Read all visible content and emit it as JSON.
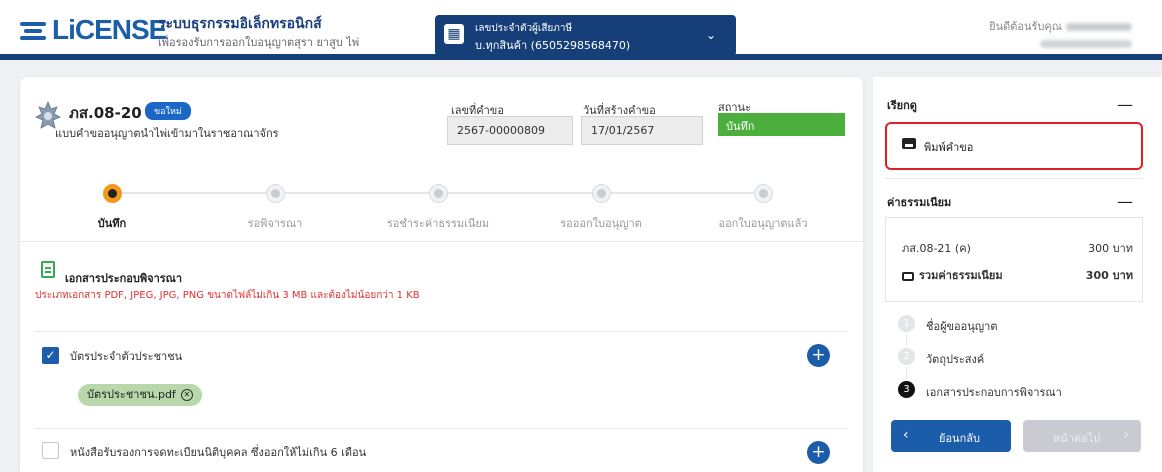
{
  "header": {
    "logo_text": "LiCENSE",
    "system_title": "ระบบธุรกรรมอิเล็กทรอนิกส์",
    "system_subtitle": "เพื่อรองรับการออกใบอนุญาตสุรา ยาสูบ ไพ่",
    "taxpayer_label": "เลขประจำตัวผู้เสียภาษี",
    "taxpayer_value": "บ.ทุกสินค้า (6505298568470)",
    "welcome_text": "ยินดีต้อนรับคุณ"
  },
  "form": {
    "code": "ภส.08-20",
    "badge": "ขอใหม่",
    "name": "แบบคำขออนุญาตนำไพ่เข้ามาในราชอาณาจักร",
    "request_no_label": "เลขที่คำขอ",
    "request_no": "2567-00000809",
    "created_label": "วันที่สร้างคำขอ",
    "created_date": "17/01/2567",
    "status_label": "สถานะ",
    "status_value": "บันทึก"
  },
  "steps": [
    {
      "label": "บันทึก",
      "active": true
    },
    {
      "label": "รอพิจารณา",
      "active": false
    },
    {
      "label": "รอชำระค่าธรรมเนียม",
      "active": false
    },
    {
      "label": "รอออกใบอนุญาต",
      "active": false
    },
    {
      "label": "ออกใบอนุญาตแล้ว",
      "active": false
    }
  ],
  "documents": {
    "title": "เอกสารประกอบพิจารณา",
    "note": "ประเภทเอกสาร PDF, JPEG, JPG, PNG ขนาดไฟล์ไม่เกิน 3 MB และต้องไม่น้อยกว่า 1 KB",
    "items": [
      {
        "label": "บัตรประจำตัวประชาชน",
        "checked": true,
        "file": "บัตรประชาชน.pdf"
      },
      {
        "label": "หนังสือรับรองการจดทะเบียนนิติบุคคล ซึ่งออกให้ไม่เกิน 6 เดือน",
        "checked": false
      }
    ]
  },
  "side": {
    "actions_title": "เรียกดู",
    "print_label": "พิมพ์คำขอ",
    "fees_title": "ค่าธรรมเนียม",
    "fee_item": "ภส.08-21 (ค)",
    "fee_amount": "300 บาท",
    "fee_total_label": "รวมค่าธรรมเนียม",
    "fee_total": "300 บาท",
    "nav": [
      {
        "num": "1",
        "label": "ชื่อผู้ขออนุญาต",
        "active": false
      },
      {
        "num": "2",
        "label": "วัตถุประสงค์",
        "active": false
      },
      {
        "num": "3",
        "label": "เอกสารประกอบการพิจารณา",
        "active": true
      }
    ],
    "back_label": "ย้อนกลับ",
    "next_label": "หน้าต่อไป"
  },
  "icons": {
    "building": "building-icon",
    "chevron": "chevron-down-icon",
    "plus": "plus-icon",
    "print": "printer-icon",
    "document": "document-icon",
    "close": "close-circle-icon"
  },
  "colors": {
    "primary": "#163e78",
    "accent": "#1c5dab",
    "status_green": "#4caf3d",
    "step_active": "#f3981c",
    "alert": "#e02121"
  }
}
